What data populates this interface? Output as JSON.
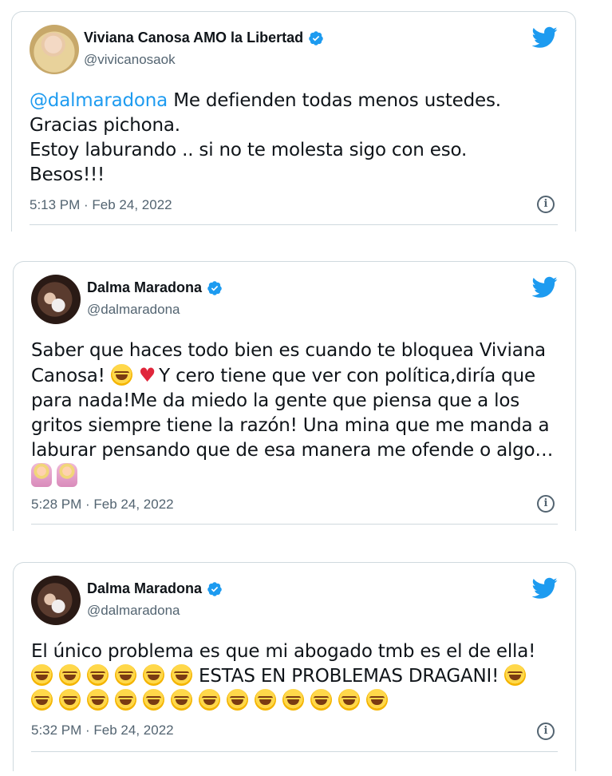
{
  "tweets": [
    {
      "display_name": "Viviana Canosa AMO la Libertad",
      "handle": "@vivicanosaok",
      "mention": "@dalmaradona",
      "lines": [
        "Me defienden todas menos ustedes.",
        "Gracias pichona.",
        "Estoy laburando .. si no te molesta sigo con eso.",
        "Besos!!!"
      ],
      "timestamp": "5:13 PM · Feb 24, 2022"
    },
    {
      "display_name": "Dalma Maradona",
      "handle": "@dalmaradona",
      "lines": [
        "Saber que haces todo bien es cuando te bloquea Viviana",
        "Y cero tiene que ver con política,diría que",
        "para nada!Me da miedo la gente que piensa que a los",
        "gritos siempre tiene la razón! Una mina que me manda a",
        "laburar pensando que de esa manera me ofende o algo…"
      ],
      "line2_prefix": "Canosa!",
      "timestamp": "5:28 PM · Feb 24, 2022"
    },
    {
      "display_name": "Dalma Maradona",
      "handle": "@dalmaradona",
      "lines": [
        "El único problema es que mi abogado tmb es el de ella!",
        "ESTAS EN PROBLEMAS DRAGANI!"
      ],
      "timestamp": "5:32 PM · Feb 24, 2022"
    }
  ],
  "icons": {
    "brand": "twitter-bird-icon",
    "verified": "verified-badge-icon",
    "info": "info-icon"
  },
  "colors": {
    "brand_blue": "#1d9bf0",
    "text": "#0f1419",
    "muted": "#536471",
    "border": "#cfd9de"
  }
}
